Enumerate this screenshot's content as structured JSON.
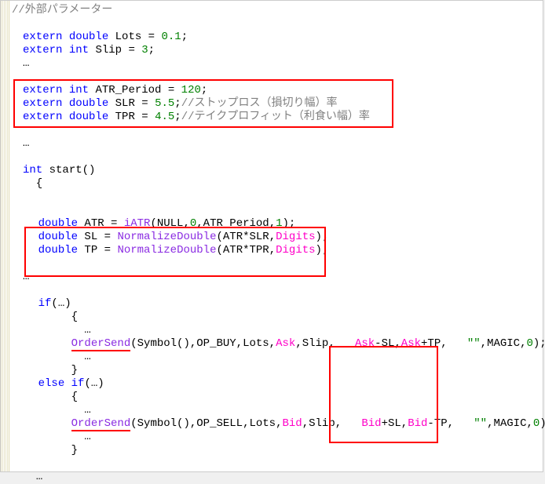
{
  "c": {
    "comment_header": "//外部パラメーター",
    "k_extern": "extern",
    "k_double": "double",
    "k_int": "int",
    "k_else": "else",
    "k_if": "if",
    "id_lots": " Lots = ",
    "id_slip": " Slip = ",
    "id_atrp": " ATR_Period = ",
    "id_slr": " SLR = ",
    "id_tpr": " TPR = ",
    "v_lots": "0.1",
    "v_slip": "3",
    "v_atrp": "120",
    "v_slr": "5.5",
    "v_tpr": "4.5",
    "semi": ";",
    "dots": "…",
    "cmt_slr": "//ストップロス（損切り幅）率",
    "cmt_tpr": "//テイクプロフィット（利食い幅）率",
    "start_sig_a": " start()",
    "brace_o": "{",
    "brace_c": "}",
    "brace_o_i": "  {",
    "brace_c_i": "  }",
    "d_atr_a": " ATR = ",
    "fn_iatr": "iATR",
    "iatr_args_a": "(NULL,",
    "iatr_args_b": ",ATR_Period,",
    "iatr_args_c": ");",
    "zero": "0",
    "one": "1",
    "d_sl_a": " SL = ",
    "d_tp_a": " TP = ",
    "fn_norm": "NormalizeDouble",
    "norm_sl": "(ATR*SLR,",
    "norm_tp": "(ATR*TPR,",
    "arg_digits": "Digits",
    "close_paren": ");",
    "if_line": "(",
    "if_close": ")",
    "dots3": "  …",
    "brace_o_d": "     {",
    "brace_c_d": "     }",
    "os": "OrderSend",
    "os_buy_a": "(Symbol(),OP_BUY,Lots,",
    "os_sell_a": "(Symbol(),OP_SELL,Lots,",
    "arg_ask": "Ask",
    "arg_bid": "Bid",
    "comma": ",",
    "slip": "Slip",
    "space2": "  ",
    "minus": "-",
    "plus": "+",
    "sl": "SL",
    "tp": "TP",
    "tail_q": "\"\"",
    "tail_rest": ",MAGIC,",
    "tail_end": ");"
  }
}
